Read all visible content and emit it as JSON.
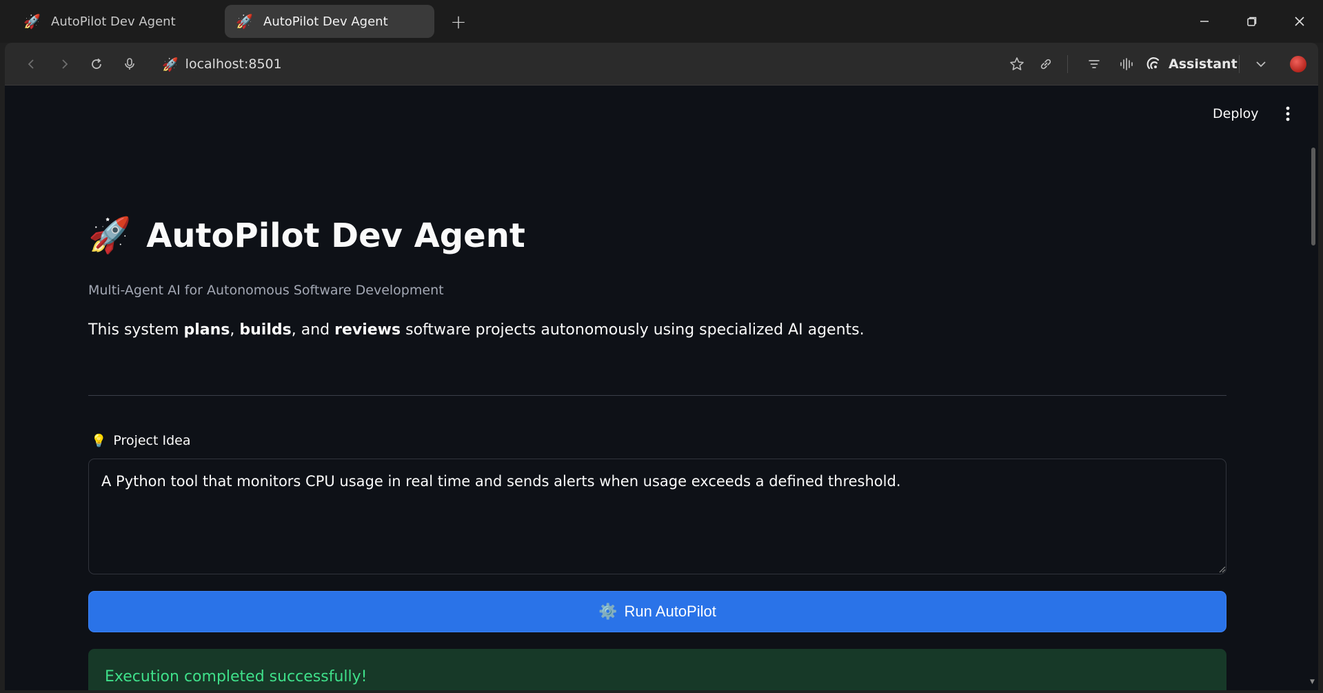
{
  "browser": {
    "tabs": [
      {
        "favicon": "🚀",
        "title": "AutoPilot Dev Agent",
        "active": false
      },
      {
        "favicon": "🚀",
        "title": "AutoPilot Dev Agent",
        "active": true
      }
    ],
    "new_tab_label": "+",
    "address": {
      "favicon": "🚀",
      "url": "localhost:8501"
    },
    "assistant_label": "Assistant",
    "icons": {
      "back": "chevron-left-icon",
      "forward": "chevron-right-icon",
      "reload": "reload-icon",
      "mic": "microphone-icon",
      "bookmark": "star-icon",
      "link": "link-icon",
      "reader": "reader-icon",
      "voice": "audio-wave-icon",
      "menu": "chevron-down-icon"
    }
  },
  "app": {
    "header": {
      "deploy_label": "Deploy"
    },
    "title_emoji": "🚀",
    "title": "AutoPilot Dev Agent",
    "subtitle": "Multi-Agent AI for Autonomous Software Development",
    "description": {
      "prefix": "This system ",
      "bold1": "plans",
      "sep1": ", ",
      "bold2": "builds",
      "sep2": ", and ",
      "bold3": "reviews",
      "suffix": " software projects autonomously using specialized AI agents."
    },
    "project_idea": {
      "emoji": "💡",
      "label": "Project Idea",
      "value": "A Python tool that monitors CPU usage in real time and sends alerts when usage exceeds a defined threshold."
    },
    "run_button": {
      "icon": "⚙️",
      "label": "Run AutoPilot"
    },
    "success_message": "Execution completed successfully!"
  },
  "colors": {
    "page_bg": "#0e1117",
    "primary_button": "#2a73e8",
    "success_bg": "#173928",
    "success_text": "#3fe08a"
  }
}
